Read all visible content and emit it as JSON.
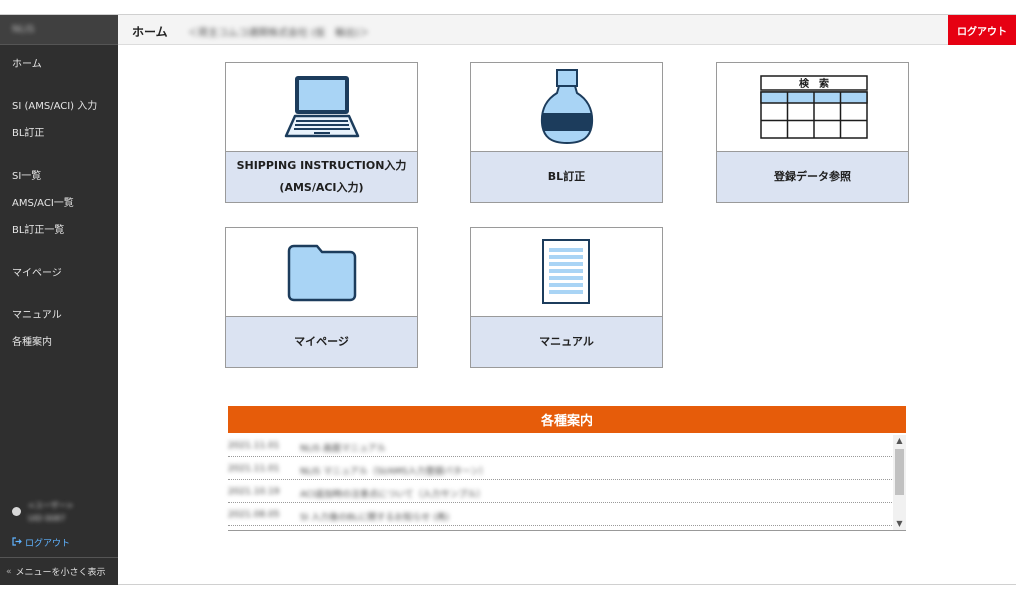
{
  "sidebar": {
    "brand": "NLIS",
    "items": [
      {
        "label": "ホーム"
      },
      {
        "label": "SI (AMS/ACI) 入力"
      },
      {
        "label": "BL訂正"
      },
      {
        "label": "SI一覧"
      },
      {
        "label": "AMS/ACI一覧"
      },
      {
        "label": "BL訂正一覧"
      },
      {
        "label": "マイページ"
      },
      {
        "label": "マニュアル"
      },
      {
        "label": "各種案内"
      }
    ],
    "user_name": "<ユーザー>",
    "user_id": "UID 0087",
    "logout_icon": "logout-arrow-icon",
    "logout_label": "ログアウト",
    "collapse_label": "メニューを小さく表示"
  },
  "header": {
    "title": "ホーム",
    "company": "＜荷主コムコ通関株式会社 (仮　輸出)＞",
    "logout_label": "ログアウト",
    "logout_color": "#e60012"
  },
  "tiles": [
    {
      "icon": "laptop-icon",
      "label_line1": "SHIPPING INSTRUCTION入力",
      "label_line2": "(AMS/ACI入力)"
    },
    {
      "icon": "bottle-icon",
      "label_line1": "BL訂正",
      "label_line2": ""
    },
    {
      "icon": "search-table-icon",
      "label_line1": "登録データ参照",
      "label_line2": "",
      "icon_text": "検　索"
    },
    {
      "icon": "folder-icon",
      "label_line1": "マイページ",
      "label_line2": ""
    },
    {
      "icon": "document-icon",
      "label_line1": "マニュアル",
      "label_line2": ""
    }
  ],
  "notices": {
    "title": "各種案内",
    "accent": "#e65c0a",
    "items": [
      {
        "date": "2021.11.01",
        "text": "NLIS 画面マニュアル"
      },
      {
        "date": "2021.11.01",
        "text": "NLIS マニュアル（SI/AMS入力登録パターン）"
      },
      {
        "date": "2021.10.19",
        "text": "ACI追加時の注意点について（入力サンプル）"
      },
      {
        "date": "2021.08.05",
        "text": "SI 入力後のBLに関するお知らせ (再)"
      }
    ]
  },
  "colors": {
    "sidebar_bg": "#2f2f2f",
    "tile_label_bg": "#dbe3f2",
    "icon_fill": "#a9d4f5",
    "icon_stroke": "#1c3c5c"
  }
}
